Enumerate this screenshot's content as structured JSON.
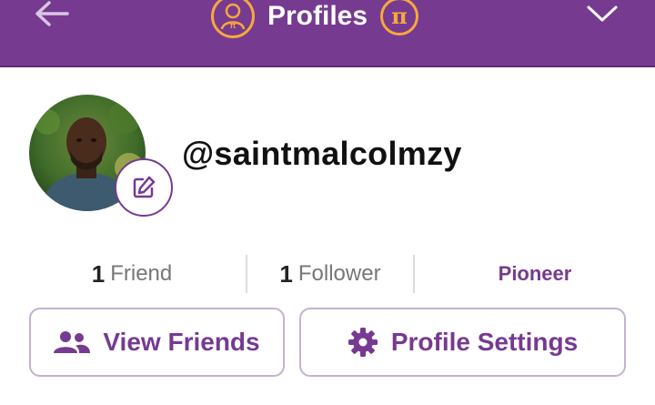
{
  "header": {
    "title": "Profiles",
    "back_icon": "arrow-left-icon",
    "profile_icon": "user-circle-icon",
    "pi_icon": "pi-coin-icon",
    "menu_icon": "chevron-down-icon"
  },
  "profile": {
    "username": "@saintmalcolmzy",
    "edit_icon": "edit-pencil-icon"
  },
  "stats": {
    "friends_count": "1",
    "friends_label": "Friend",
    "followers_count": "1",
    "followers_label": "Follower",
    "role": "Pioneer"
  },
  "actions": {
    "view_friends": "View Friends",
    "profile_settings": "Profile Settings"
  },
  "colors": {
    "brand": "#763a91",
    "accent": "#f5a93a"
  }
}
